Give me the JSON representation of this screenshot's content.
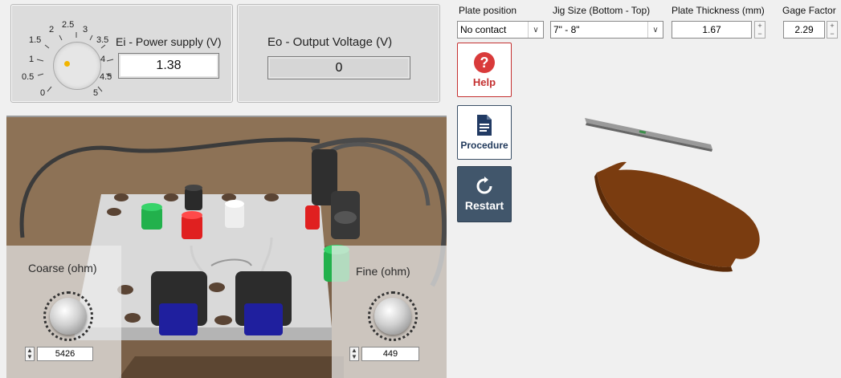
{
  "power_panel": {
    "title": "Ei - Power supply (V)",
    "value": "1.38",
    "dial_ticks": [
      "0",
      "0.5",
      "1",
      "1.5",
      "2",
      "2.5",
      "3",
      "3.5",
      "4",
      "4.5",
      "5"
    ]
  },
  "output_panel": {
    "title": "Eo - Output Voltage (V)",
    "value": "0"
  },
  "controls": {
    "plate_position": {
      "label": "Plate position",
      "value": "No contact"
    },
    "jig_size": {
      "label": "Jig Size (Bottom - Top)",
      "value": "7\" - 8\""
    },
    "plate_thickness": {
      "label": "Plate Thickness (mm)",
      "value": "1.67"
    },
    "gage_factor": {
      "label": "Gage Factor",
      "value": "2.29"
    }
  },
  "buttons": {
    "help": "Help",
    "procedure": "Procedure",
    "restart": "Restart"
  },
  "scene": {
    "coarse": {
      "label": "Coarse (ohm)",
      "value": "5426"
    },
    "fine": {
      "label": "Fine (ohm)",
      "value": "449"
    }
  },
  "colors": {
    "help_red": "#d93a3a",
    "procedure_navy": "#213a63",
    "restart_bg": "#41566b",
    "plate_brown": "#7a3c10",
    "terminal_green": "#22b14c",
    "terminal_red": "#e02020",
    "knob_base_blue": "#1f1f9e"
  }
}
